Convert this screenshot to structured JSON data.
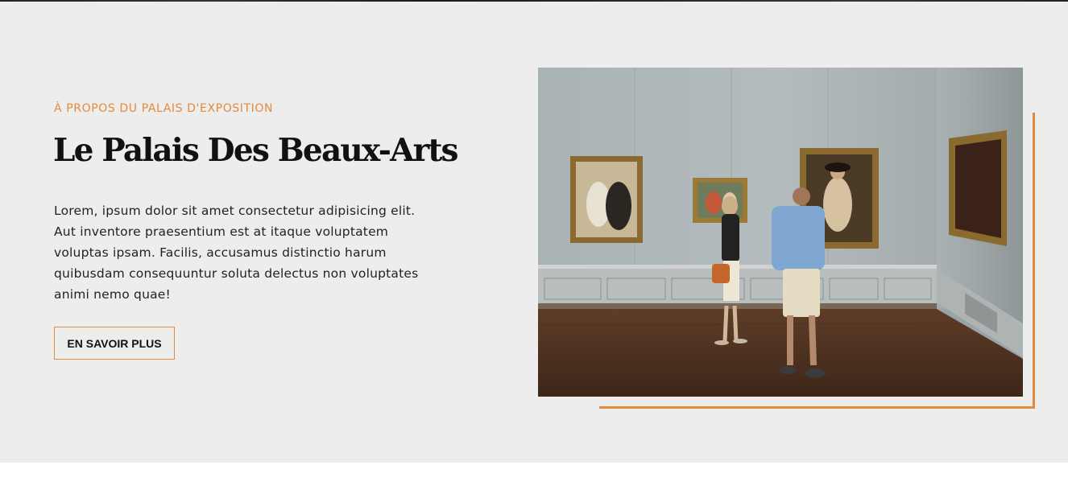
{
  "about": {
    "eyebrow": "À PROPOS DU PALAIS D'EXPOSITION",
    "title": "Le Palais Des Beaux-Arts",
    "body": "Lorem, ipsum dolor sit amet consectetur adipisicing elit. Aut inventore praesentium est at itaque voluptatem voluptas ipsam. Facilis, accusamus distinctio harum quibusdam consequuntur soluta delectus non voluptates animi nemo quae!",
    "button_label": "EN SAVOIR PLUS"
  },
  "colors": {
    "accent": "#e38a3c",
    "section_background": "#ededed",
    "title_text": "#111111",
    "body_text": "#222222"
  },
  "image": {
    "icon": "gallery-photo"
  }
}
